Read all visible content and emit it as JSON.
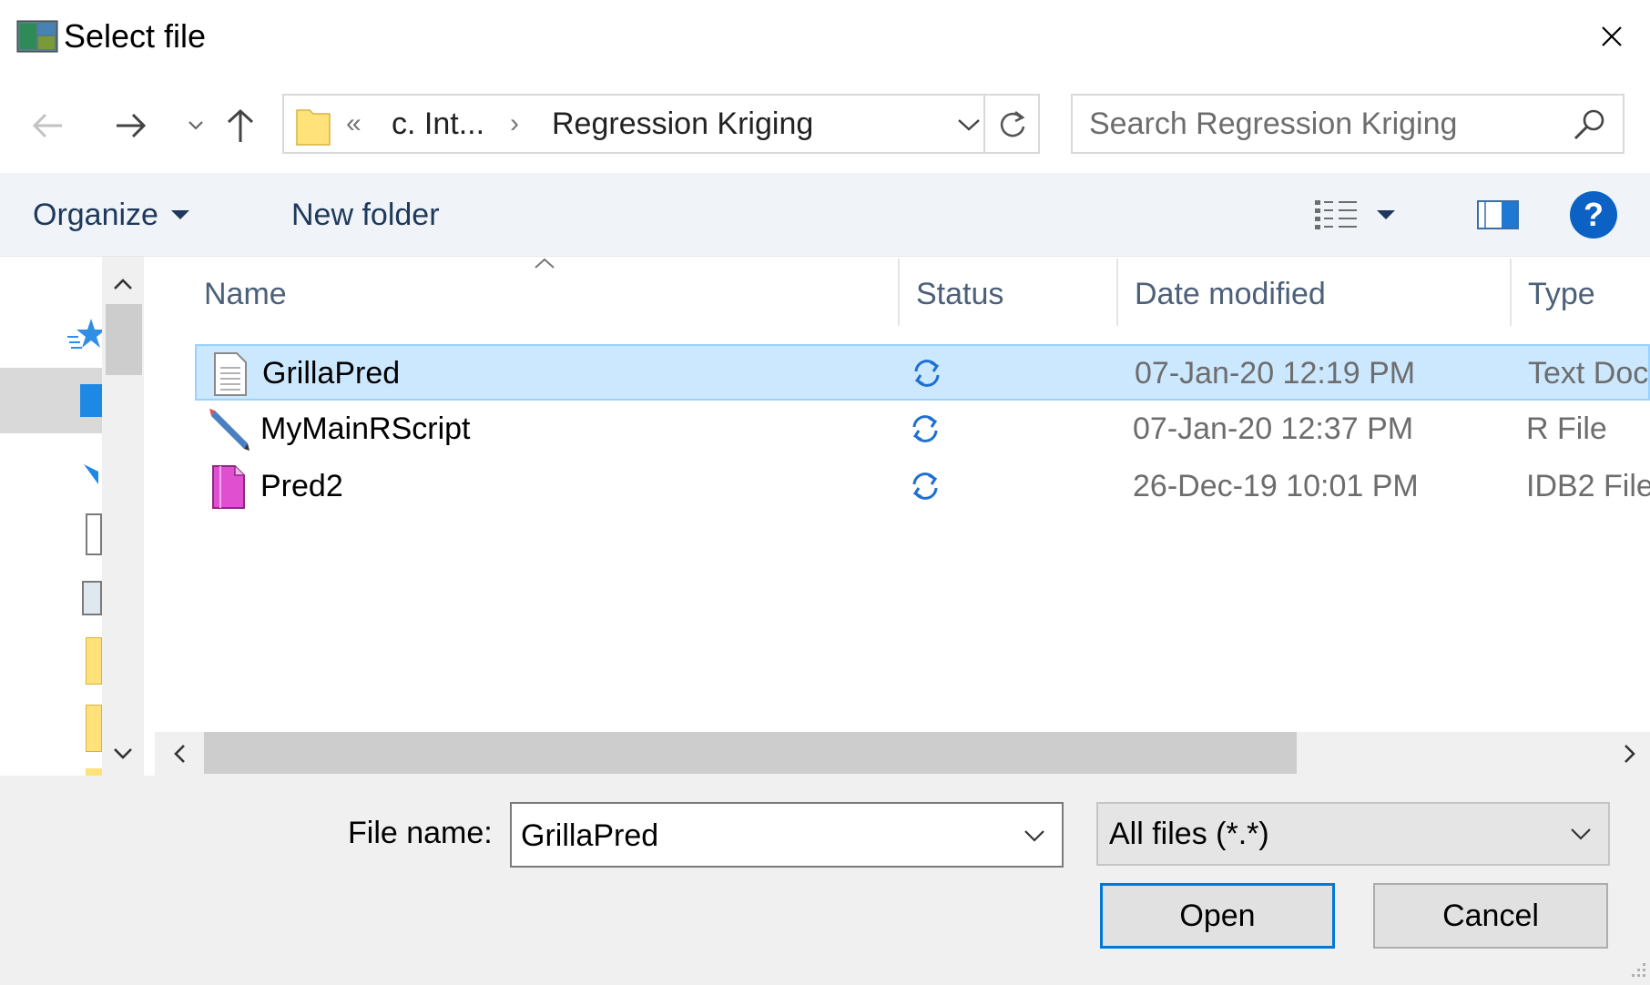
{
  "window": {
    "title": "Select file",
    "icons": {
      "app": "app-icon",
      "close": "close-icon"
    }
  },
  "nav": {
    "back_icon": "back-arrow-icon",
    "forward_icon": "forward-arrow-icon",
    "recent_icon": "chevron-down-icon",
    "up_icon": "up-arrow-icon"
  },
  "address": {
    "overflow": "«",
    "segments": [
      "c. Int...",
      "Regression Kriging"
    ],
    "separator": "›",
    "folder_icon": "folder-icon",
    "refresh_icon": "refresh-icon"
  },
  "search": {
    "placeholder": "Search Regression Kriging",
    "icon": "search-icon"
  },
  "toolbar": {
    "organize_label": "Organize",
    "new_folder_label": "New folder",
    "view_icon": "details-view-icon",
    "preview_icon": "preview-pane-icon",
    "help_label": "?"
  },
  "columns": {
    "name": "Name",
    "status": "Status",
    "date": "Date modified",
    "type": "Type"
  },
  "files": [
    {
      "name": "GrillaPred",
      "date": "07-Jan-20 12:19 PM",
      "type": "Text Doc",
      "icon": "text-document-icon",
      "status": "sync-icon",
      "selected": true
    },
    {
      "name": "MyMainRScript",
      "date": "07-Jan-20 12:37 PM",
      "type": "R File",
      "icon": "r-script-icon",
      "status": "sync-icon",
      "selected": false
    },
    {
      "name": "Pred2",
      "date": "26-Dec-19 10:01 PM",
      "type": "IDB2 File",
      "icon": "idb2-file-icon",
      "status": "sync-icon",
      "selected": false
    }
  ],
  "bottom": {
    "file_name_label": "File name:",
    "file_name_value": "GrillaPred",
    "file_type_value": "All files (*.*)",
    "open_label": "Open",
    "cancel_label": "Cancel"
  },
  "colors": {
    "selection": "#cce8ff",
    "selection_border": "#99d1ff",
    "accent": "#0078d7",
    "help": "#0b61c4",
    "sync": "#1f6fd1",
    "toolbar_bg": "#f0f4f9",
    "footer_bg": "#f0f0f0"
  }
}
